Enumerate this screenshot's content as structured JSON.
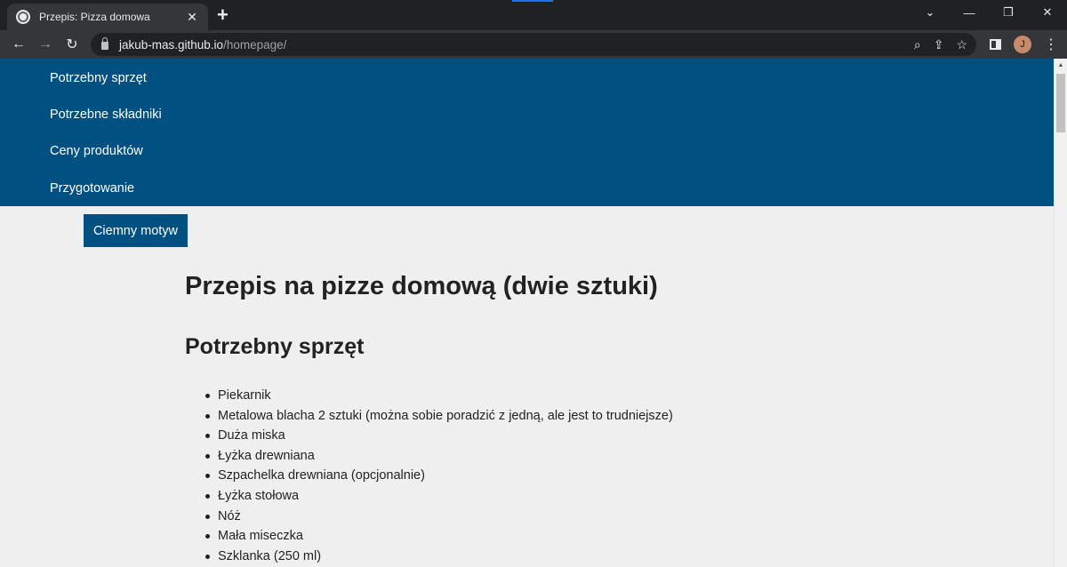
{
  "browser": {
    "tab_title": "Przepis: Pizza domowa",
    "tab_close": "✕",
    "new_tab": "+",
    "url_host": "jakub-mas.github.io",
    "url_path": "/homepage/",
    "avatar_letter": "J",
    "window_controls": {
      "chevron": "⌄",
      "minimize": "—",
      "restore": "❐",
      "close": "✕"
    },
    "nav": {
      "back": "←",
      "forward": "→",
      "reload": "↻"
    },
    "omni_icons": {
      "zoom": "⌕",
      "share": "⇪",
      "bookmark": "☆"
    },
    "menu": "⋮"
  },
  "nav": {
    "items": [
      "Potrzebny sprzęt",
      "Potrzebne składniki",
      "Ceny produktów",
      "Przygotowanie"
    ]
  },
  "theme_button": "Ciemny motyw",
  "content": {
    "title": "Przepis na pizze domową (dwie sztuki)",
    "section_title": "Potrzebny sprzęt",
    "equipment": [
      "Piekarnik",
      "Metalowa blacha 2 sztuki (można sobie poradzić z jedną, ale jest to trudniejsze)",
      "Duża miska",
      "Łyżka drewniana",
      "Szpachelka drewniana (opcjonalnie)",
      "Łyżka stołowa",
      "Nóż",
      "Mała miseczka",
      "Szklanka (250 ml)"
    ]
  },
  "colors": {
    "nav_bg": "#005182",
    "page_bg": "#efefef",
    "text": "#222222"
  }
}
